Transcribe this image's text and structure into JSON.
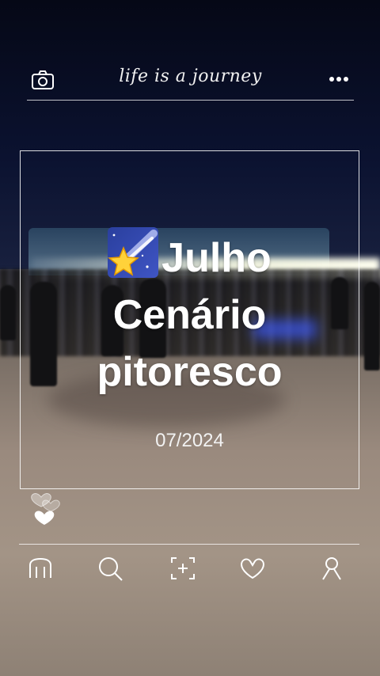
{
  "header": {
    "tagline": "life is a journey",
    "left_icon": "camera-icon",
    "right_icon": "more-dots-icon"
  },
  "card": {
    "emoji": "shooting-star-emoji",
    "title_line1": "Julho",
    "title_line2": "Cenário",
    "title_line3": "pitoresco",
    "date": "07/2024"
  },
  "reactions": {
    "icons": [
      "heart-outline-icon",
      "heart-outline-icon",
      "heart-filled-icon"
    ]
  },
  "bottom_nav": {
    "items": [
      {
        "icon": "home-icon"
      },
      {
        "icon": "search-icon"
      },
      {
        "icon": "add-frame-icon"
      },
      {
        "icon": "heart-icon"
      },
      {
        "icon": "profile-icon"
      }
    ]
  },
  "colors": {
    "line": "#ffffff",
    "emoji_bg": "#3148b8",
    "star": "#ffd23a"
  }
}
